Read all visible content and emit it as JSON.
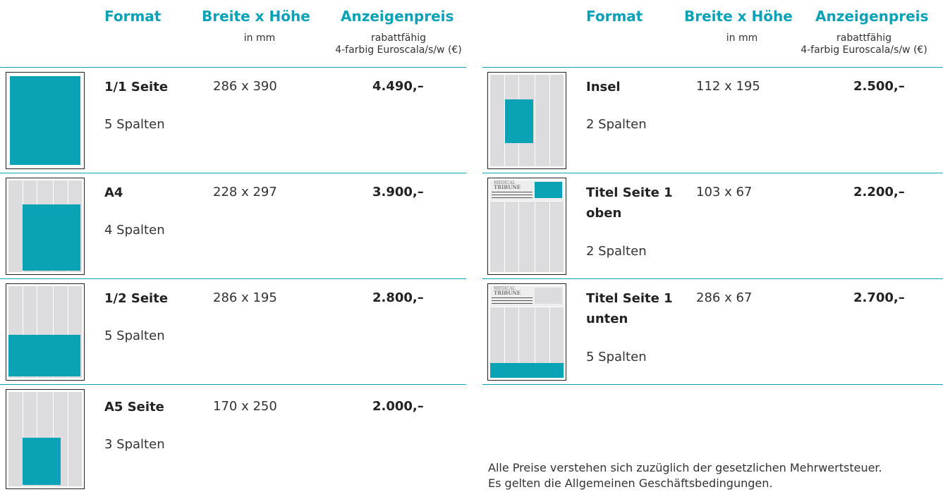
{
  "header": {
    "format": "Format",
    "dimensions": "Breite x Höhe",
    "dimensions_unit": "in mm",
    "price": "Anzeigenpreis",
    "price_note_1": "rabattfähig",
    "price_note_2": "4-farbig Euroscala/s/w (€)"
  },
  "left_rows": [
    {
      "format": "1/1 Seite",
      "size": "286 x 390",
      "price": "4.490,–",
      "columns": "5 Spalten"
    },
    {
      "format": "A4",
      "size": "228 x 297",
      "price": "3.900,–",
      "columns": "4 Spalten"
    },
    {
      "format": "1/2 Seite",
      "size": "286 x 195",
      "price": "2.800,–",
      "columns": "5 Spalten"
    },
    {
      "format": "A5 Seite",
      "size": "170 x 250",
      "price": "2.000,–",
      "columns": "3 Spalten"
    }
  ],
  "right_rows": [
    {
      "format": "Insel",
      "size": "112 x 195",
      "price": "2.500,–",
      "columns": "2 Spalten"
    },
    {
      "format_1": "Titel Seite 1",
      "format_2": "oben",
      "size": "103 x 67",
      "price": "2.200,–",
      "columns": "2 Spalten",
      "masthead": [
        "MEDICAL",
        "TRIBUNE"
      ]
    },
    {
      "format_1": "Titel Seite 1",
      "format_2": "unten",
      "size": "286 x 67",
      "price": "2.700,–",
      "columns": "5 Spalten",
      "masthead": [
        "MEDICAL",
        "TRIBUNE"
      ]
    }
  ],
  "footer": {
    "line1": "Alle Preise verstehen sich zuzüglich der gesetzlichen Mehrwertsteuer.",
    "line2": "Es gelten die Allgemeinen Geschäftsbedingungen."
  },
  "colors": {
    "accent": "#0ba2b7",
    "page_grey": "#dcdcde"
  }
}
